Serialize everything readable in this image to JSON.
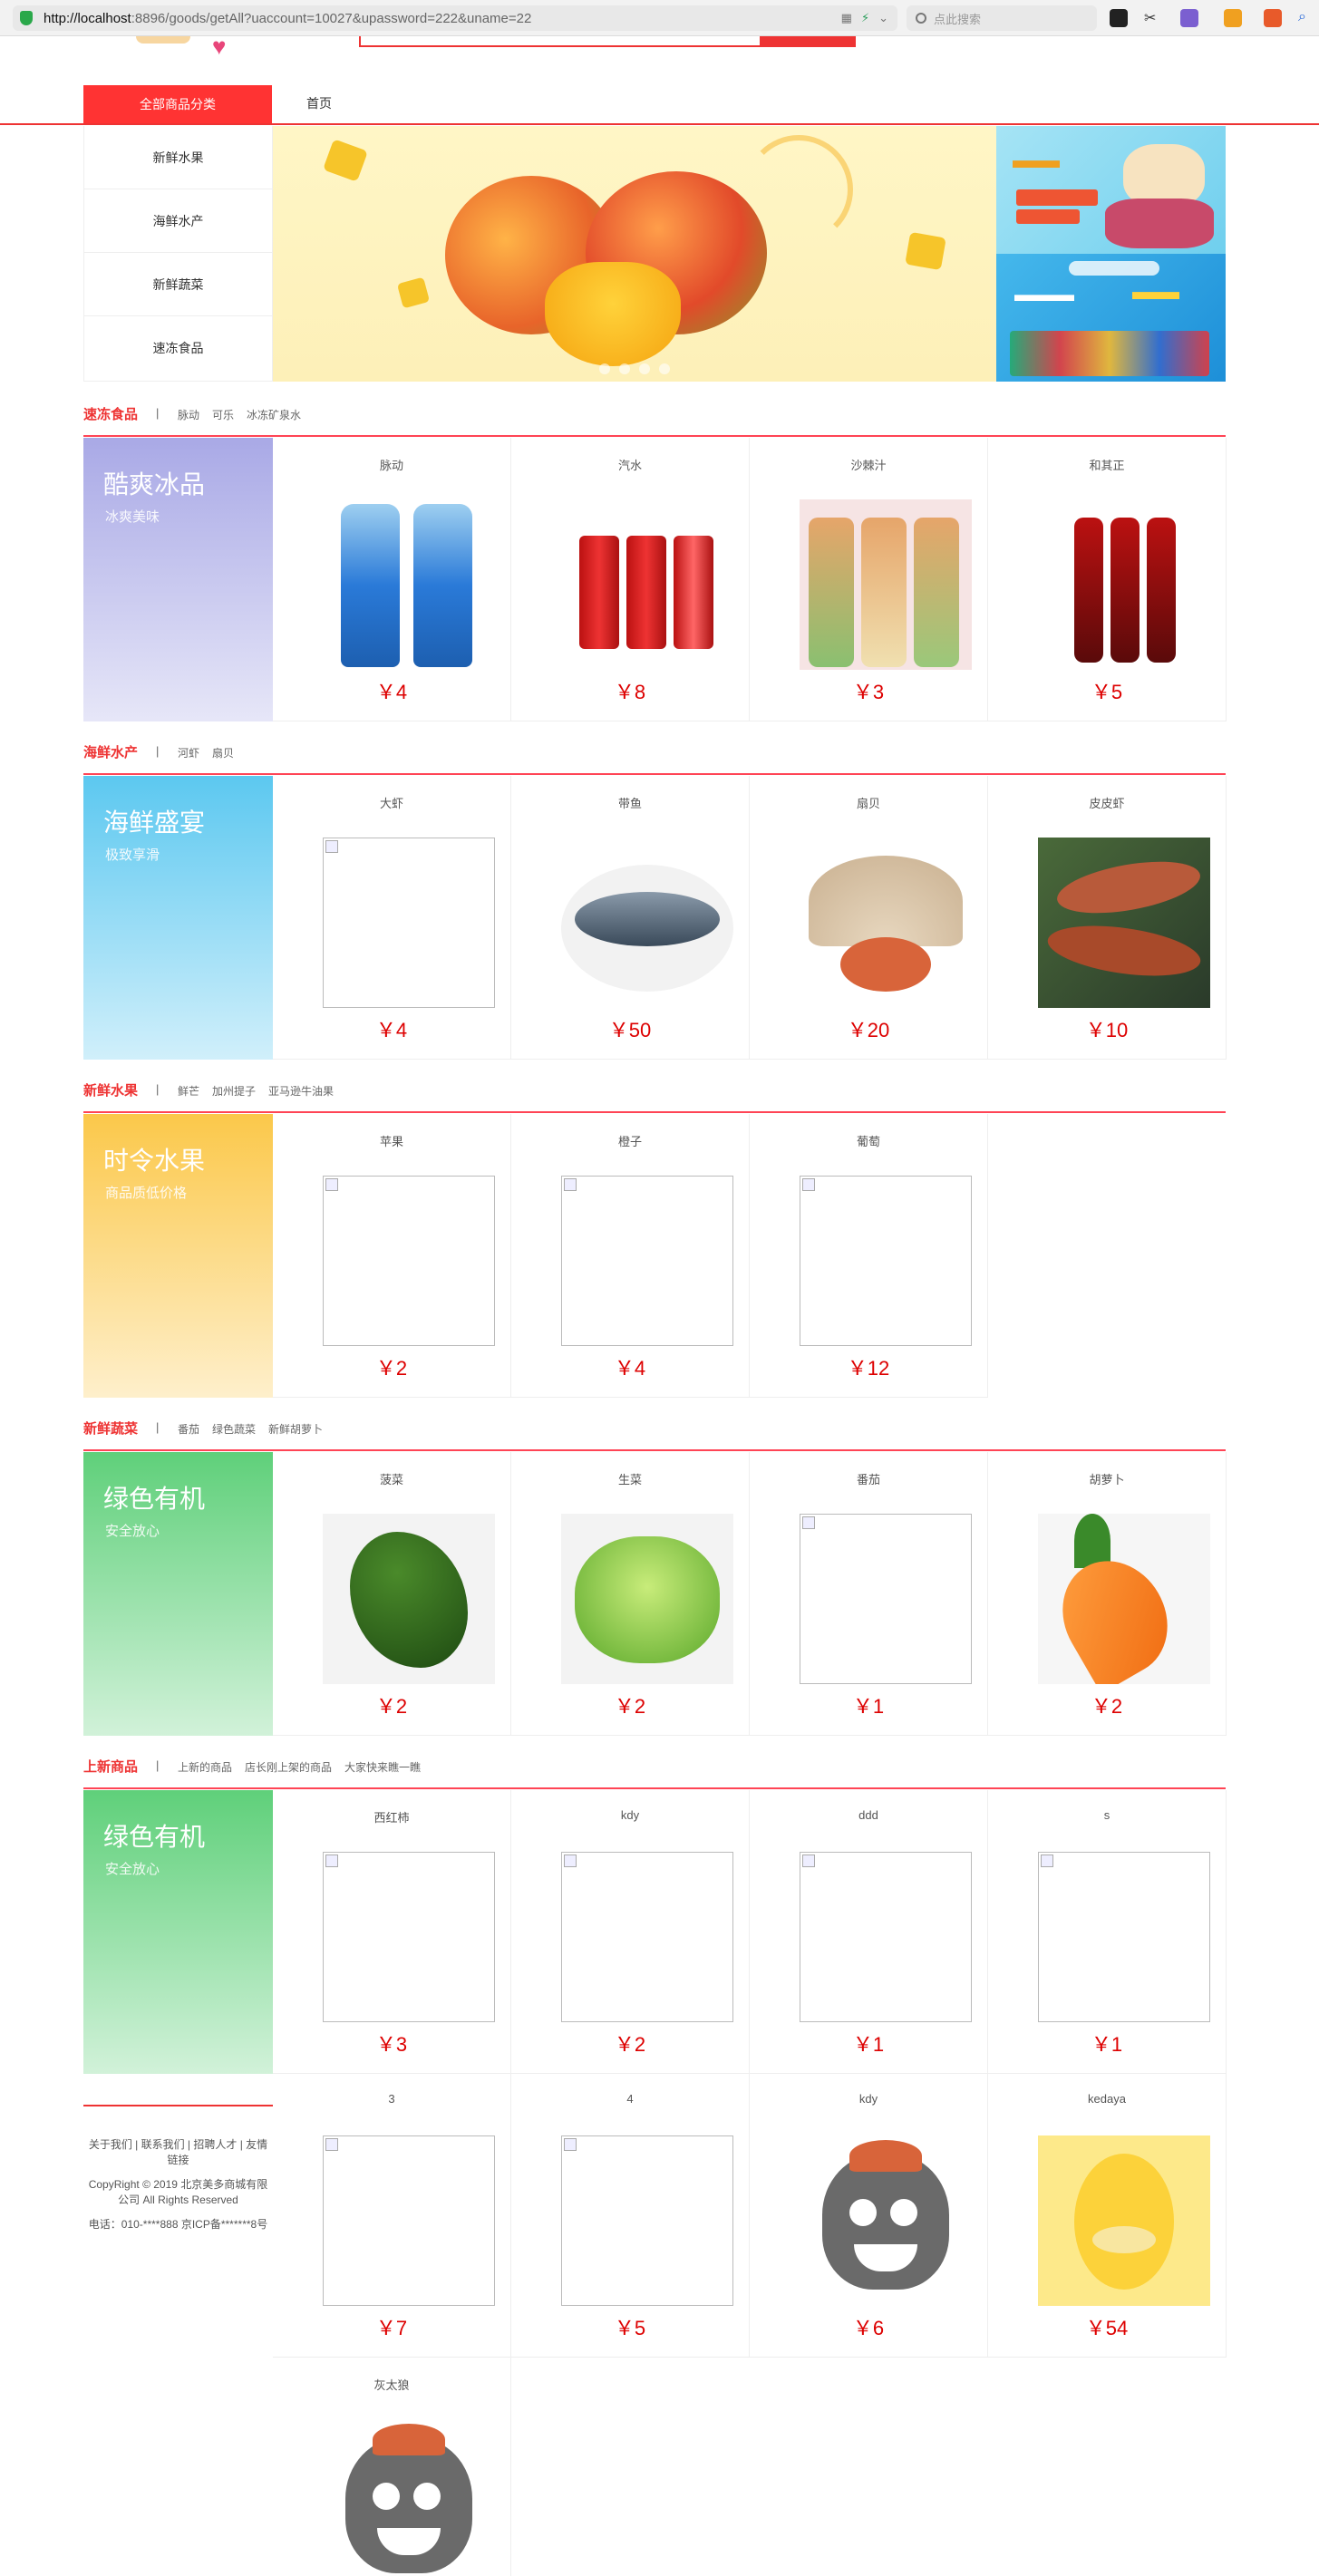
{
  "browser": {
    "url_host": "http://localhost",
    "url_rest": ":8896/goods/getAll?uaccount=10027&upassword=222&uname=22",
    "search_placeholder": "点此搜索"
  },
  "nav": {
    "all_categories": "全部商品分类",
    "home": "首页"
  },
  "categories": [
    "新鲜水果",
    "海鲜水产",
    "新鲜蔬菜",
    "速冻食品"
  ],
  "sections": [
    {
      "title": "速冻食品",
      "sep": "|",
      "tags": [
        "脉动",
        "可乐",
        "冰冻矿泉水"
      ],
      "side_title": "酷爽冰品",
      "side_sub": "冰爽美味",
      "side_color": "#a9a9e6",
      "products": [
        {
          "name": "脉动",
          "price": "￥4",
          "img": "drink-blue"
        },
        {
          "name": "汽水",
          "price": "￥8",
          "img": "can-red"
        },
        {
          "name": "沙棘汁",
          "price": "￥3",
          "img": "juice"
        },
        {
          "name": "和其正",
          "price": "￥5",
          "img": "tea-red"
        }
      ]
    },
    {
      "title": "海鲜水产",
      "sep": "|",
      "tags": [
        "河虾",
        "扇贝"
      ],
      "side_title": "海鲜盛宴",
      "side_sub": "极致享滑",
      "side_color": "#5cc8f0",
      "products": [
        {
          "name": "大虾",
          "price": "￥4",
          "img": "broken"
        },
        {
          "name": "带鱼",
          "price": "￥50",
          "img": "fish"
        },
        {
          "name": "扇贝",
          "price": "￥20",
          "img": "scallop"
        },
        {
          "name": "皮皮虾",
          "price": "￥10",
          "img": "shrimp"
        }
      ]
    },
    {
      "title": "新鲜水果",
      "sep": "|",
      "tags": [
        "鲜芒",
        "加州提子",
        "亚马逊牛油果"
      ],
      "side_title": "时令水果",
      "side_sub": "商品质低价格",
      "side_color": "#fbc84a",
      "products": [
        {
          "name": "苹果",
          "price": "￥2",
          "img": "broken"
        },
        {
          "name": "橙子",
          "price": "￥4",
          "img": "broken"
        },
        {
          "name": "葡萄",
          "price": "￥12",
          "img": "broken"
        }
      ]
    },
    {
      "title": "新鲜蔬菜",
      "sep": "|",
      "tags": [
        "番茄",
        "绿色蔬菜",
        "新鲜胡萝卜"
      ],
      "side_title": "绿色有机",
      "side_sub": "安全放心",
      "side_color": "#5fd07a",
      "products": [
        {
          "name": "菠菜",
          "price": "￥2",
          "img": "greens"
        },
        {
          "name": "生菜",
          "price": "￥2",
          "img": "lettuce"
        },
        {
          "name": "番茄",
          "price": "￥1",
          "img": "broken"
        },
        {
          "name": "胡萝卜",
          "price": "￥2",
          "img": "carrot"
        }
      ]
    },
    {
      "title": "上新商品",
      "sep": "|",
      "tags": [
        "上新的商品",
        "店长刚上架的商品",
        "大家快来瞧一瞧"
      ],
      "side_title": "绿色有机",
      "side_sub": "安全放心",
      "side_color": "#5fd07a",
      "products": [
        {
          "name": "西红柿",
          "price": "￥3",
          "img": "broken"
        },
        {
          "name": "kdy",
          "price": "￥2",
          "img": "broken"
        },
        {
          "name": "ddd",
          "price": "￥1",
          "img": "broken"
        },
        {
          "name": "s",
          "price": "￥1",
          "img": "broken"
        },
        {
          "name": "3",
          "price": "￥7",
          "img": "broken"
        },
        {
          "name": "4",
          "price": "￥5",
          "img": "broken"
        },
        {
          "name": "kdy",
          "price": "￥6",
          "img": "wolf"
        },
        {
          "name": "kedaya",
          "price": "￥54",
          "img": "duck"
        },
        {
          "name": "灰太狼",
          "price": "",
          "img": "wolf"
        }
      ]
    }
  ],
  "footer": {
    "links": "关于我们 | 联系我们 | 招聘人才 | 友情链接",
    "copyright": "CopyRight © 2019 北京美多商城有限公司 All Rights Reserved",
    "phone": "电话：010-****888 京ICP备*******8号"
  }
}
